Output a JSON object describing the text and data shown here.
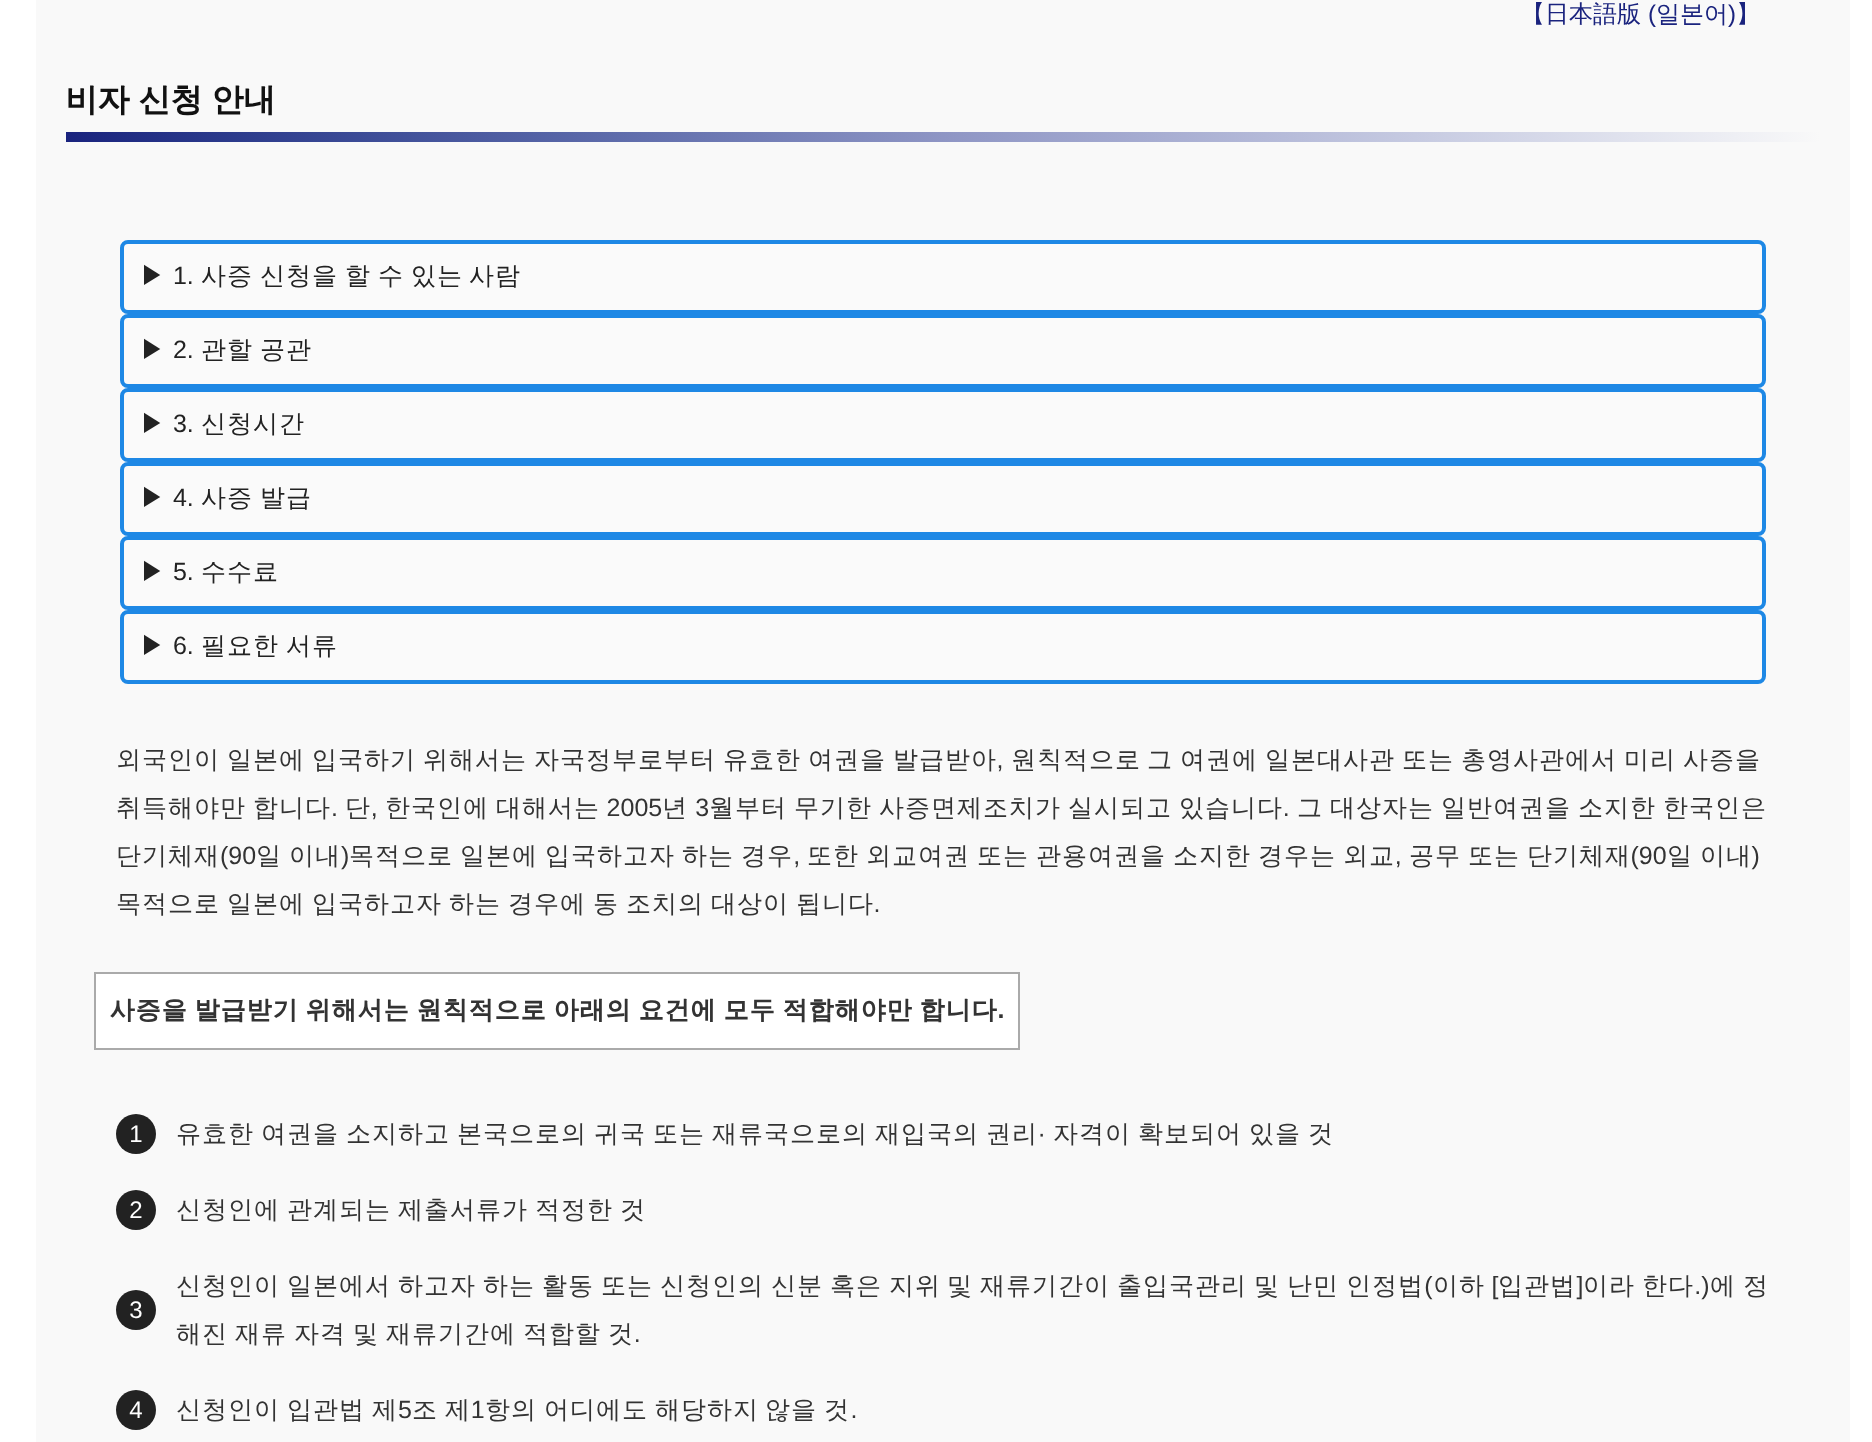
{
  "language_link": "【日本語版 (일본어)】",
  "page_title": "비자 신청 안내",
  "accordion": [
    {
      "label": "▶ 1. 사증 신청을 할 수 있는 사람",
      "expanded": false
    },
    {
      "label": "▶ 2. 관할 공관",
      "expanded": false
    },
    {
      "label": "▶ 3. 신청시간",
      "expanded": false
    },
    {
      "label": "▶ 4. 사증 발급",
      "expanded": false
    },
    {
      "label": "▶ 5. 수수료",
      "expanded": false
    },
    {
      "label": "▶ 6. 필요한 서류",
      "expanded": false
    }
  ],
  "intro": "외국인이 일본에 입국하기 위해서는 자국정부로부터 유효한 여권을 발급받아, 원칙적으로 그 여권에 일본대사관 또는 총영사관에서 미리 사증을 취득해야만 합니다. 단, 한국인에 대해서는 2005년 3월부터 무기한 사증면제조치가 실시되고 있습니다. 그 대상자는 일반여권을 소지한 한국인은 단기체재(90일 이내)목적으로 일본에 입국하고자 하는 경우, 또한 외교여권 또는 관용여권을 소지한 경우는 외교, 공무 또는 단기체재(90일 이내)목적으로 일본에 입국하고자 하는 경우에 동 조치의 대상이 됩니다.",
  "notice": "사증을 발급받기 위해서는 원칙적으로 아래의 요건에 모두 적합해야만 합니다.",
  "requirements": [
    {
      "number": "1",
      "text": "유효한 여권을 소지하고 본국으로의 귀국 또는 재류국으로의 재입국의 권리· 자격이 확보되어 있을 것"
    },
    {
      "number": "2",
      "text": "신청인에 관계되는 제출서류가 적정한 것"
    },
    {
      "number": "3",
      "text": "신청인이 일본에서 하고자 하는 활동 또는 신청인의 신분 혹은 지위 및 재류기간이 출입국관리 및 난민 인정법(이하 [입관법]이라 한다.)에 정해진 재류 자격 및 재류기간에 적합할 것."
    },
    {
      "number": "4",
      "text": "신청인이 입관법 제5조 제1항의 어디에도 해당하지 않을 것."
    }
  ]
}
